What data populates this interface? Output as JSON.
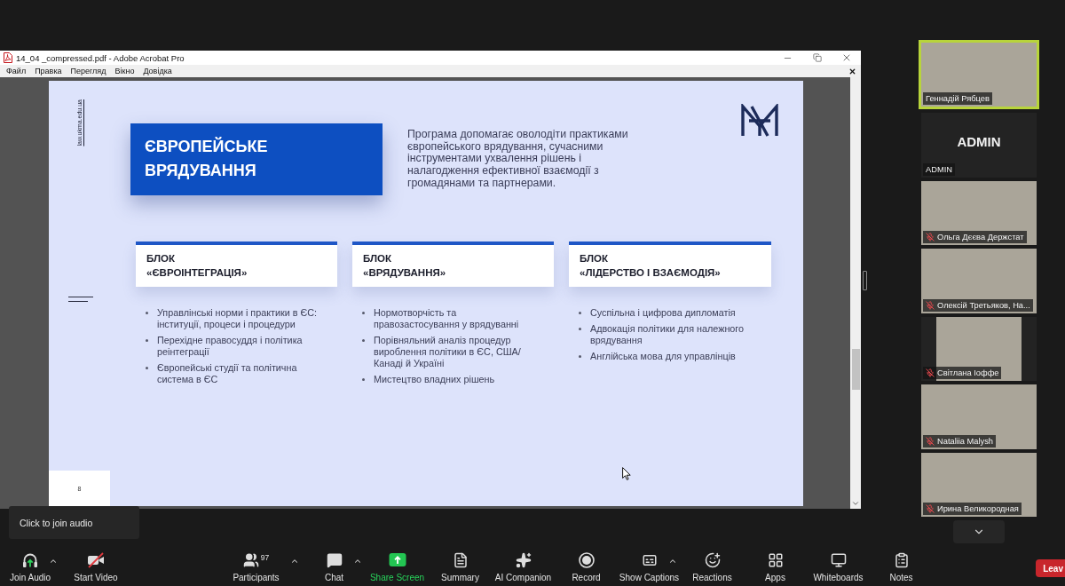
{
  "pdf_window": {
    "title": "14_04 _compressed.pdf - Adobe Acrobat Pro",
    "menu": [
      "Файл",
      "Правка",
      "Перегляд",
      "Вікно",
      "Довідка"
    ]
  },
  "slide": {
    "site": "law.ukma.edu.ua",
    "title": "ЄВРОПЕЙСЬКЕ ВРЯДУВАННЯ",
    "intro": "Програма допомагає оволодіти практиками європейського врядування, сучасними інструментами ухвалення рішень і налагодження ефективної взаємодії з громадянами та партнерами.",
    "blocks": [
      {
        "label": "БЛОК",
        "title": "«ЄВРОІНТЕГРАЦІЯ»",
        "items": [
          "Управлінські норми і практики в ЄС: інституції, процеси і процедури",
          "Перехідне правосуддя і політика реінтеграції",
          "Європейські студії та політична система в ЄС"
        ]
      },
      {
        "label": "БЛОК",
        "title": "«ВРЯДУВАННЯ»",
        "items": [
          "Нормотворчість та правозастосування у врядуванні",
          "Порівняльний аналіз процедур вироблення політики в ЄС, США/ Канаді й Україні",
          "Мистецтво владних рішень"
        ]
      },
      {
        "label": "БЛОК",
        "title": "«ЛІДЕРСТВО І ВЗАЄМОДІЯ»",
        "items": [
          "Суспільна і цифрова дипломатія",
          "Адвокація політики для належного врядування",
          "Англійська мова для управлінців"
        ]
      }
    ],
    "page_number": "8"
  },
  "participants": [
    {
      "kind": "video",
      "name": "Геннадій Рябцев",
      "muted": false,
      "active_speaker": true
    },
    {
      "kind": "name-card",
      "card_text": "ADMIN",
      "name": "ADMIN",
      "muted": false,
      "active_speaker": false
    },
    {
      "kind": "video",
      "name": "Ольга Дєєва Держстат",
      "muted": true,
      "active_speaker": false
    },
    {
      "kind": "video",
      "name": "Олексій Третьяков, На...",
      "muted": true,
      "active_speaker": false
    },
    {
      "kind": "video-pillarbox",
      "name": "Світлана Іоффе",
      "muted": true,
      "active_speaker": false
    },
    {
      "kind": "video",
      "name": "Nataliia Malysh",
      "muted": true,
      "active_speaker": false
    },
    {
      "kind": "video",
      "name": "Ирина Великородная",
      "muted": true,
      "active_speaker": false
    }
  ],
  "tooltip": "Click to join audio",
  "toolbar": {
    "left": [
      {
        "kind": "audio",
        "label": "Join Audio",
        "menu": true
      },
      {
        "kind": "video",
        "label": "Start Video",
        "menu": false
      }
    ],
    "center": [
      {
        "kind": "participants",
        "label": "Participants",
        "count": "97",
        "menu": true
      },
      {
        "kind": "chat",
        "label": "Chat",
        "menu": true
      },
      {
        "kind": "share",
        "label": "Share Screen",
        "menu": false
      },
      {
        "kind": "summary",
        "label": "Summary",
        "menu": false
      },
      {
        "kind": "ai",
        "label": "AI Companion",
        "menu": false
      },
      {
        "kind": "record",
        "label": "Record",
        "menu": false
      },
      {
        "kind": "captions",
        "label": "Show Captions",
        "menu": true
      },
      {
        "kind": "reactions",
        "label": "Reactions",
        "menu": false
      },
      {
        "kind": "apps",
        "label": "Apps",
        "menu": false
      },
      {
        "kind": "whiteboards",
        "label": "Whiteboards",
        "menu": false
      },
      {
        "kind": "notes",
        "label": "Notes",
        "menu": false
      }
    ],
    "leave": "Leav"
  }
}
